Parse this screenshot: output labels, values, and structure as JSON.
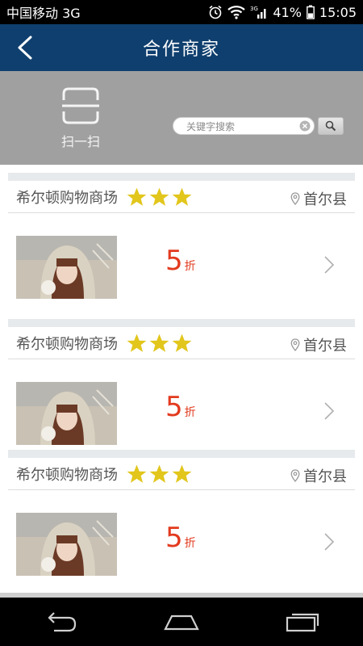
{
  "status_bar": {
    "carrier": "中国移动 3G",
    "network_label": "3G",
    "battery": "41%",
    "time": "15:05"
  },
  "header": {
    "title": "合作商家",
    "back_icon": "chevron-left-icon"
  },
  "toolbar": {
    "scan_label": "扫一扫",
    "search_placeholder": "关键字搜索"
  },
  "merchants": [
    {
      "name": "希尔顿购物商场",
      "rating": 3,
      "location": "首尔县",
      "discount_value": "5",
      "discount_unit": "折"
    },
    {
      "name": "希尔顿购物商场",
      "rating": 3,
      "location": "首尔县",
      "discount_value": "5",
      "discount_unit": "折"
    },
    {
      "name": "希尔顿购物商场",
      "rating": 3,
      "location": "首尔县",
      "discount_value": "5",
      "discount_unit": "折"
    }
  ],
  "colors": {
    "header_bg": "#0f3f6e",
    "toolbar_bg": "#a0a0a0",
    "star": "#e2c61c",
    "discount": "#e23a1e"
  }
}
